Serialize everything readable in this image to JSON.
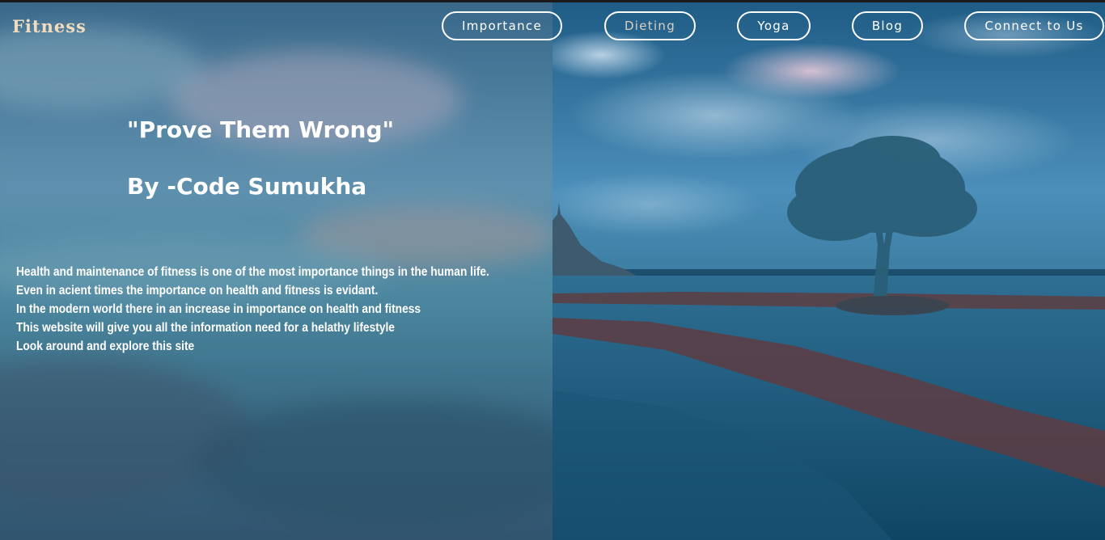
{
  "brand": "Fitness",
  "nav": {
    "items": [
      {
        "label": "Importance"
      },
      {
        "label": "Dieting"
      },
      {
        "label": "Yoga"
      },
      {
        "label": "Blog"
      },
      {
        "label": "Connect to Us"
      }
    ]
  },
  "hero": {
    "quote": "\"Prove Them Wrong\"",
    "author": "By -Code Sumukha",
    "lines": [
      "Health and maintenance of fitness is one of the most importance things in the human life.",
      "Even in acient times the importance on health and fitness is evidant.",
      "In the modern world there in an increase in importance on health and fitness",
      "This website will give you all the information need for a helathy lifestyle",
      "Look around and explore this site"
    ]
  },
  "colors": {
    "brand": "#f1dcc0",
    "nav_border": "#ffffff",
    "text": "#ffffff",
    "sky": "#3c7ea8",
    "water": "#1d5a7a",
    "shore": "#5a3a3c"
  }
}
